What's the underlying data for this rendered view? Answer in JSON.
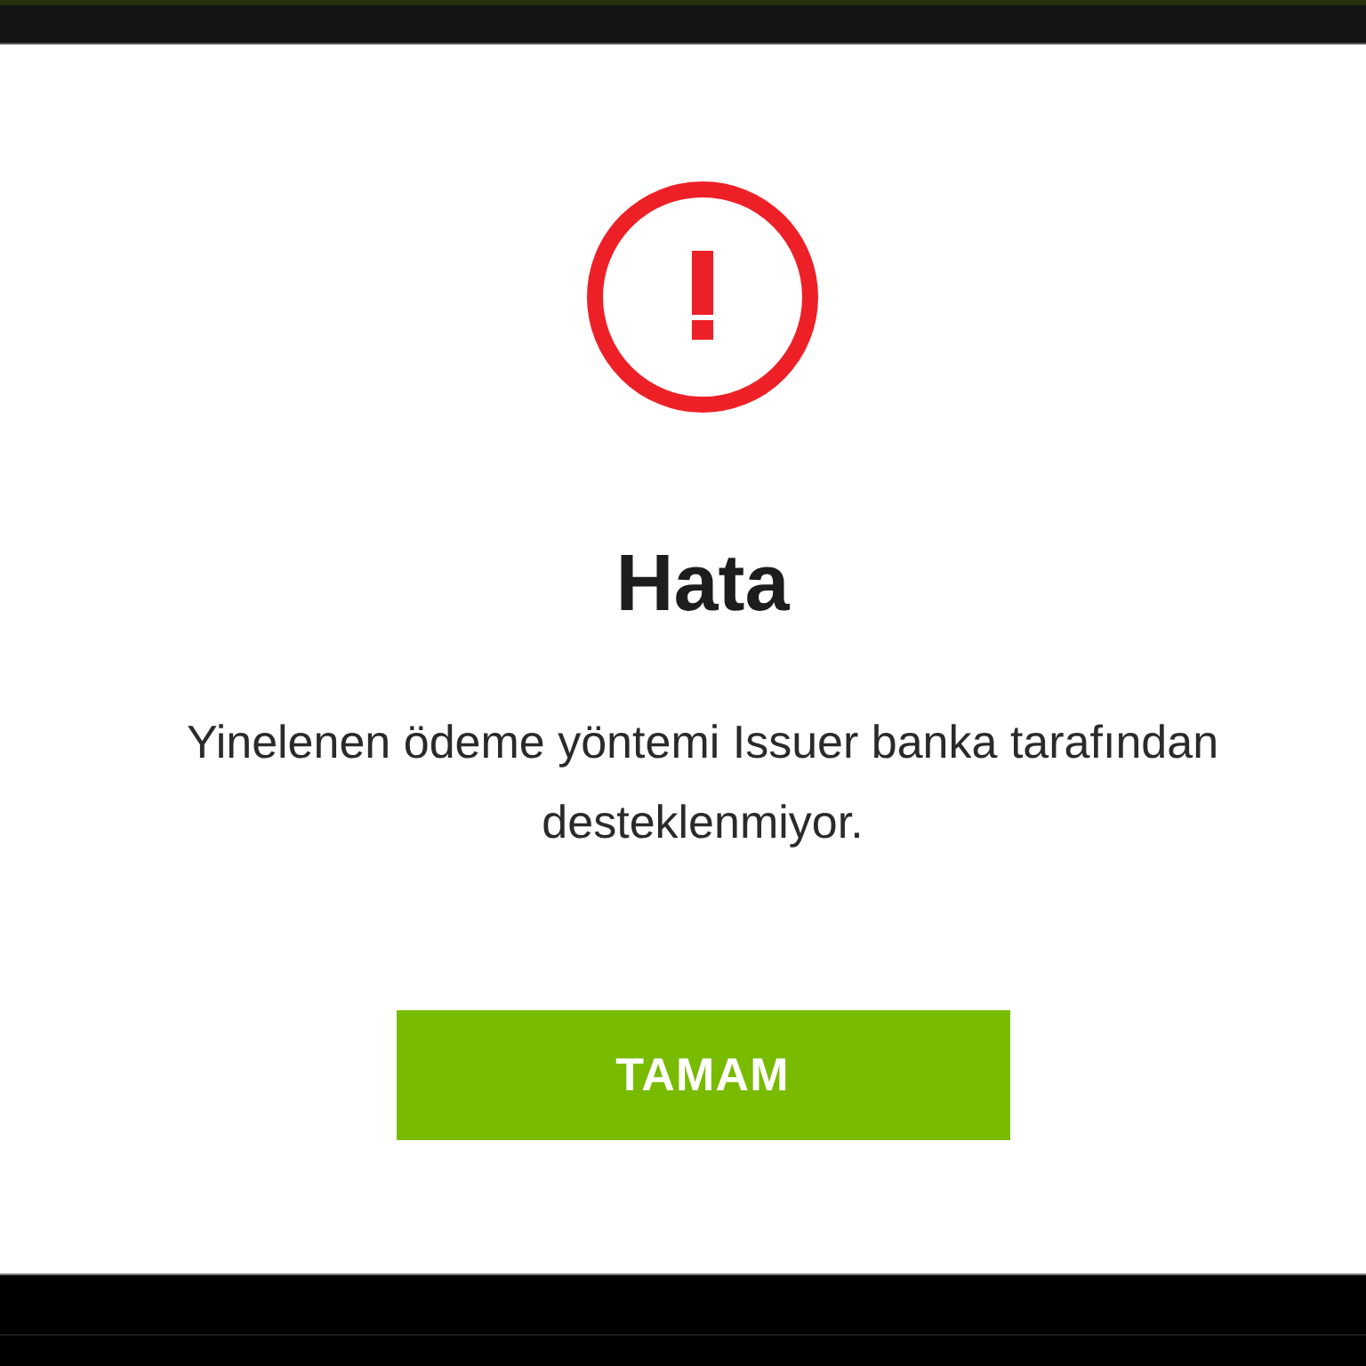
{
  "dialog": {
    "kind": "error",
    "title": "Hata",
    "message": "Yinelenen ödeme yöntemi Issuer banka tarafından desteklenmiyor.",
    "buttons": [
      {
        "label": "TAMAM"
      }
    ]
  }
}
